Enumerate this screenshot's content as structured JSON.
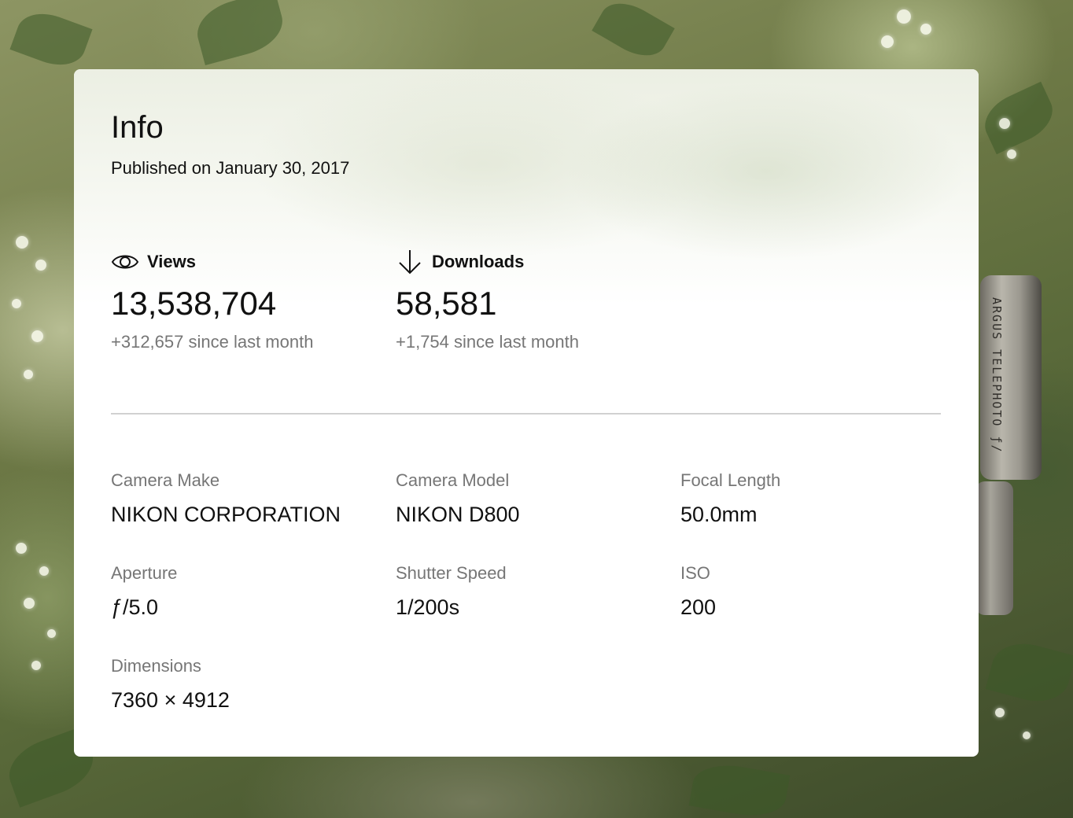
{
  "info": {
    "title": "Info",
    "published": "Published on January 30, 2017"
  },
  "stats": {
    "views": {
      "icon": "eye-icon",
      "label": "Views",
      "value": "13,538,704",
      "delta": "+312,657 since last month"
    },
    "downloads": {
      "icon": "arrow-down-icon",
      "label": "Downloads",
      "value": "58,581",
      "delta": "+1,754 since last month"
    }
  },
  "exif": {
    "camera_make": {
      "label": "Camera Make",
      "value": "NIKON CORPORATION"
    },
    "camera_model": {
      "label": "Camera Model",
      "value": "NIKON D800"
    },
    "focal_length": {
      "label": "Focal Length",
      "value": "50.0mm"
    },
    "aperture": {
      "label": "Aperture",
      "value": "ƒ/5.0"
    },
    "shutter_speed": {
      "label": "Shutter Speed",
      "value": "1/200s"
    },
    "iso": {
      "label": "ISO",
      "value": "200"
    },
    "dimensions": {
      "label": "Dimensions",
      "value": "7360 × 4912"
    }
  },
  "background": {
    "lens_text": "ARGUS TELEPHOTO ƒ/"
  },
  "colors": {
    "text_primary": "#111111",
    "text_secondary": "#767676",
    "divider": "#d1d1d1",
    "card": "#ffffff"
  }
}
